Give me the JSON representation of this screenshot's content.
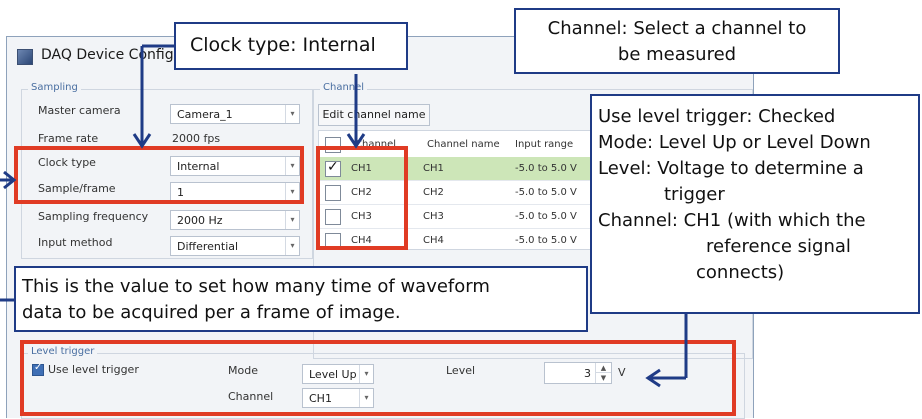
{
  "window": {
    "title": "DAQ Device Config"
  },
  "sampling": {
    "legend": "Sampling",
    "master_camera": {
      "label": "Master camera",
      "value": "Camera_1"
    },
    "frame_rate": {
      "label": "Frame rate",
      "value": "2000 fps"
    },
    "clock_type": {
      "label": "Clock type",
      "value": "Internal"
    },
    "sample_frame": {
      "label": "Sample/frame",
      "value": "1"
    },
    "sampling_frequency": {
      "label": "Sampling frequency",
      "value": "2000 Hz"
    },
    "input_method": {
      "label": "Input method",
      "value": "Differential"
    }
  },
  "channel": {
    "legend": "Channel",
    "edit_button": "Edit channel name",
    "headers": {
      "channel": "Channel",
      "channel_name": "Channel name",
      "input_range": "Input range"
    },
    "rows": [
      {
        "channel": "CH1",
        "name": "CH1",
        "range": "-5.0 to 5.0 V",
        "checked": true
      },
      {
        "channel": "CH2",
        "name": "CH2",
        "range": "-5.0 to 5.0 V",
        "checked": false
      },
      {
        "channel": "CH3",
        "name": "CH3",
        "range": "-5.0 to 5.0 V",
        "checked": false
      },
      {
        "channel": "CH4",
        "name": "CH4",
        "range": "-5.0 to 5.0 V",
        "checked": false
      }
    ]
  },
  "level_trigger": {
    "legend": "Level trigger",
    "use_label": "Use level trigger",
    "use_checked": true,
    "mode_label": "Mode",
    "mode_value": "Level Up",
    "level_label": "Level",
    "level_value": "3",
    "level_unit": "V",
    "channel_label": "Channel",
    "channel_value": "CH1"
  },
  "annotations": {
    "clock_type": "Clock type: Internal",
    "channel_select": [
      "Channel: Select a channel to",
      "be measured"
    ],
    "level_trigger_info": [
      "Use level trigger: Checked",
      "Mode: Level Up or Level Down",
      "Level: Voltage to determine a",
      "trigger",
      "Channel: CH1 (with which the",
      "reference signal",
      "connects)"
    ],
    "sample_frame_info": [
      "This is the value to set how many time of waveform",
      "data to be acquired per a frame of image."
    ]
  },
  "colors": {
    "highlight": "#e03b24",
    "callout_border": "#1f3b86",
    "selected_row": "#cde6b8"
  }
}
